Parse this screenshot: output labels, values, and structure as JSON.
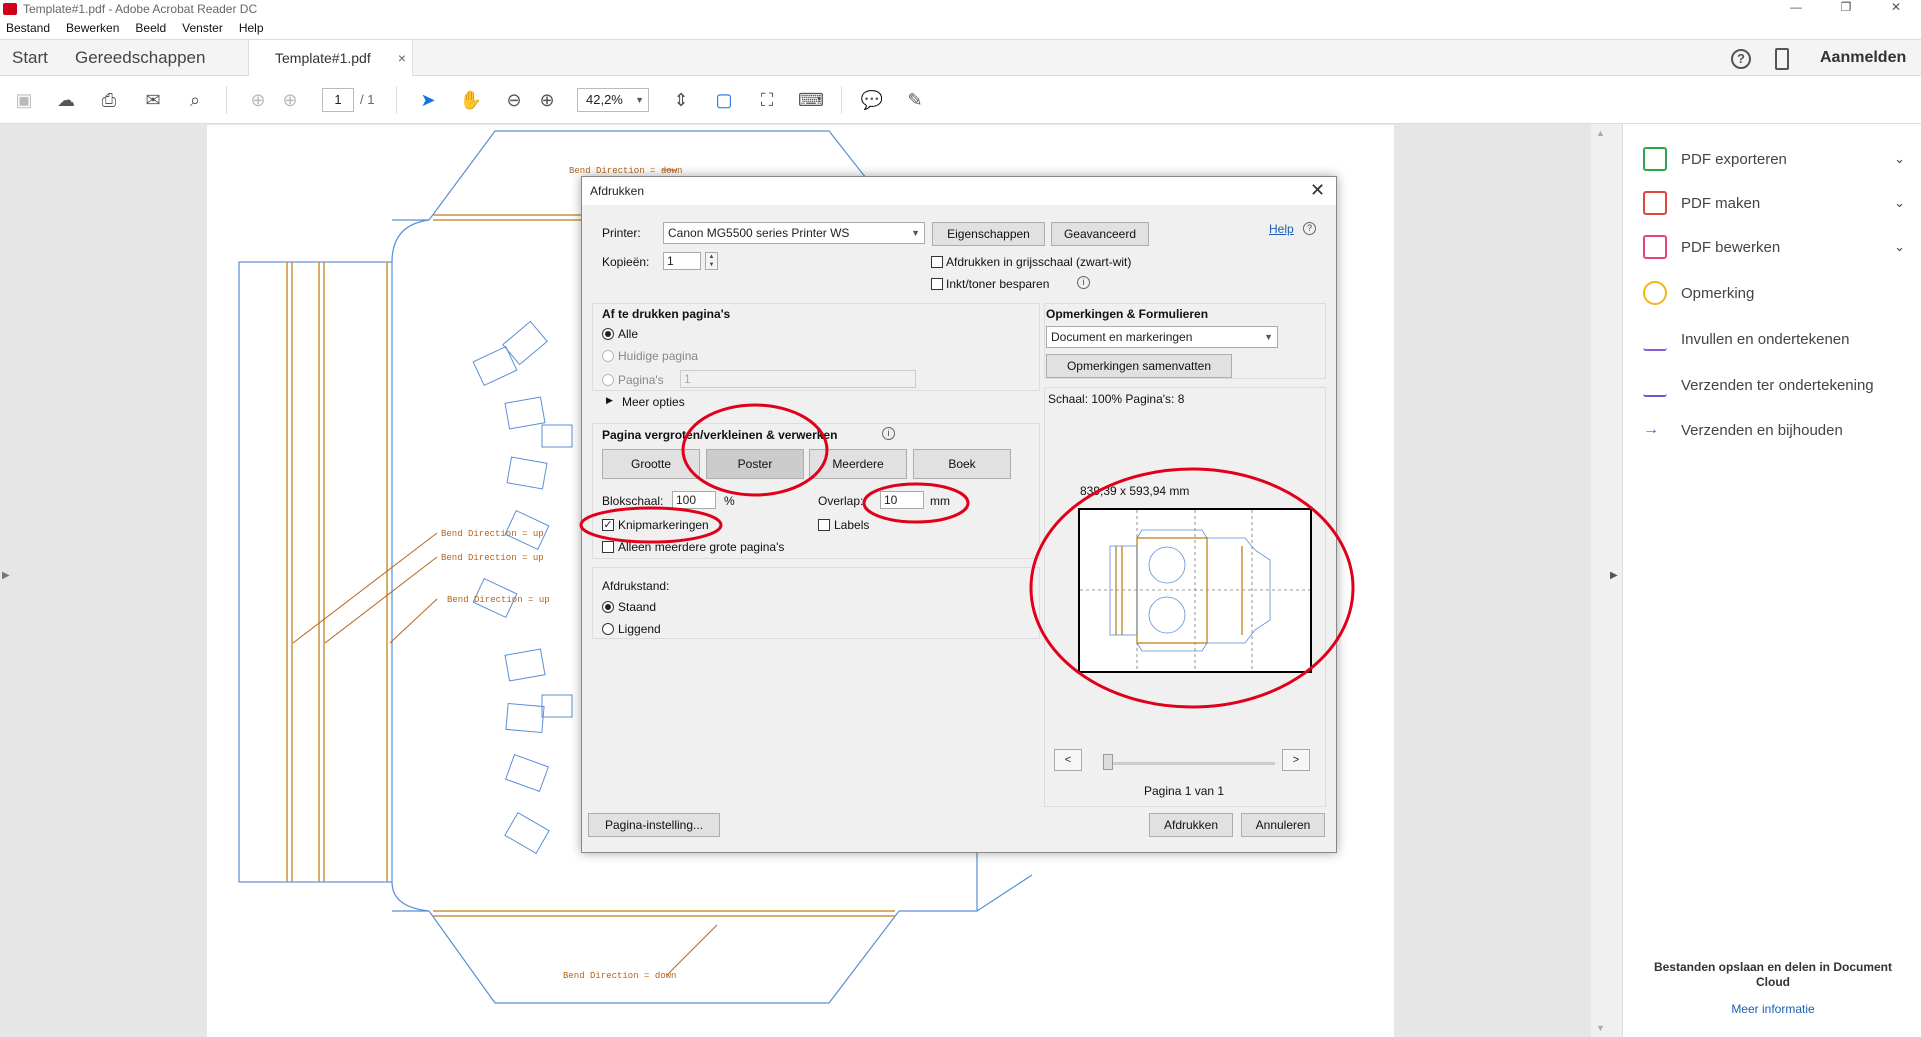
{
  "window": {
    "title": "Template#1.pdf - Adobe Acrobat Reader DC",
    "controls": [
      "—",
      "❐",
      "✕"
    ]
  },
  "menu": [
    "Bestand",
    "Bewerken",
    "Beeld",
    "Venster",
    "Help"
  ],
  "tabs": {
    "start": "Start",
    "tools": "Gereedschappen",
    "document": "Template#1.pdf",
    "close": "×",
    "help": "?",
    "signin": "Aanmelden"
  },
  "toolbar": {
    "page_current": "1",
    "page_total": "/ 1",
    "zoom": "42,2%"
  },
  "document": {
    "bend_labels": [
      "Bend Direction = down",
      "Bend Direction = up",
      "Bend Direction = up",
      "Bend Direction = up",
      "Bend Direction = down"
    ]
  },
  "right_panel": {
    "items": [
      {
        "label": "PDF exporteren",
        "chevron": true,
        "color": "#2da44e"
      },
      {
        "label": "PDF maken",
        "chevron": true,
        "color": "#e0453a"
      },
      {
        "label": "PDF bewerken",
        "chevron": true,
        "color": "#e0457a"
      },
      {
        "label": "Opmerking",
        "chevron": false,
        "color": "#f1b616"
      },
      {
        "label": "Invullen en ondertekenen",
        "chevron": false,
        "color": "#8a5cd6"
      },
      {
        "label": "Verzenden ter ondertekening",
        "chevron": false,
        "color": "#6a5acd"
      },
      {
        "label": "Verzenden en bijhouden",
        "chevron": false,
        "color": "#1473e6"
      }
    ],
    "footer": "Bestanden opslaan en delen in Document Cloud",
    "more_info": "Meer informatie"
  },
  "dialog": {
    "title": "Afdrukken",
    "printer_label": "Printer:",
    "printer_value": "Canon MG5500 series Printer WS",
    "properties_button": "Eigenschappen",
    "advanced_button": "Geavanceerd",
    "help_link": "Help",
    "copies_label": "Kopieën:",
    "copies_value": "1",
    "grayscale_label": "Afdrukken in grijsschaal (zwart-wit)",
    "save_ink_label": "Inkt/toner besparen",
    "pages_heading": "Af te drukken pagina's",
    "pages_all": "Alle",
    "pages_current": "Huidige pagina",
    "pages_range": "Pagina's",
    "pages_range_value": "1",
    "more_options": "Meer opties",
    "scale_heading": "Pagina vergroten/verkleinen & verwerken",
    "scale_buttons": [
      "Grootte",
      "Poster",
      "Meerdere",
      "Boek"
    ],
    "tile_scale_label": "Blokschaal:",
    "tile_scale_value": "100",
    "tile_scale_unit": "%",
    "overlap_label": "Overlap:",
    "overlap_value": "10",
    "overlap_unit": "mm",
    "cut_marks_label": "Knipmarkeringen",
    "labels_label": "Labels",
    "only_large_label": "Alleen meerdere grote pagina's",
    "orientation_heading": "Afdrukstand:",
    "orientation_portrait": "Staand",
    "orientation_landscape": "Liggend",
    "comments_heading": "Opmerkingen & Formulieren",
    "comments_value": "Document en markeringen",
    "summarize_button": "Opmerkingen samenvatten",
    "scale_info": "Schaal: 100% Pagina's: 8",
    "dimensions": "839,39 x 593,94 mm",
    "prev": "<",
    "next": ">",
    "page_of": "Pagina 1 van 1",
    "page_setup_button": "Pagina-instelling...",
    "print_button": "Afdrukken",
    "cancel_button": "Annuleren"
  },
  "annotation_color": "#e0001b"
}
